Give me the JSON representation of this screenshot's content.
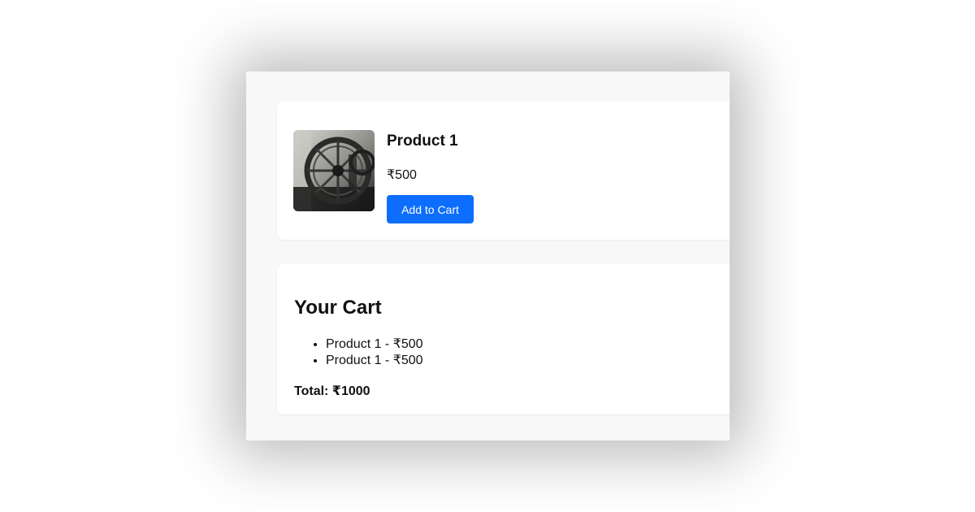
{
  "product": {
    "name": "Product 1",
    "price": "₹500",
    "add_button_label": "Add to Cart",
    "image_alt": "product-photo"
  },
  "cart": {
    "title": "Your Cart",
    "items": [
      {
        "label": "Product 1 - ₹500"
      },
      {
        "label": "Product 1 - ₹500"
      }
    ],
    "total_label": "Total: ₹1000"
  },
  "colors": {
    "accent": "#0d6efd",
    "page_bg": "#f8f8f8",
    "card_bg": "#ffffff"
  }
}
